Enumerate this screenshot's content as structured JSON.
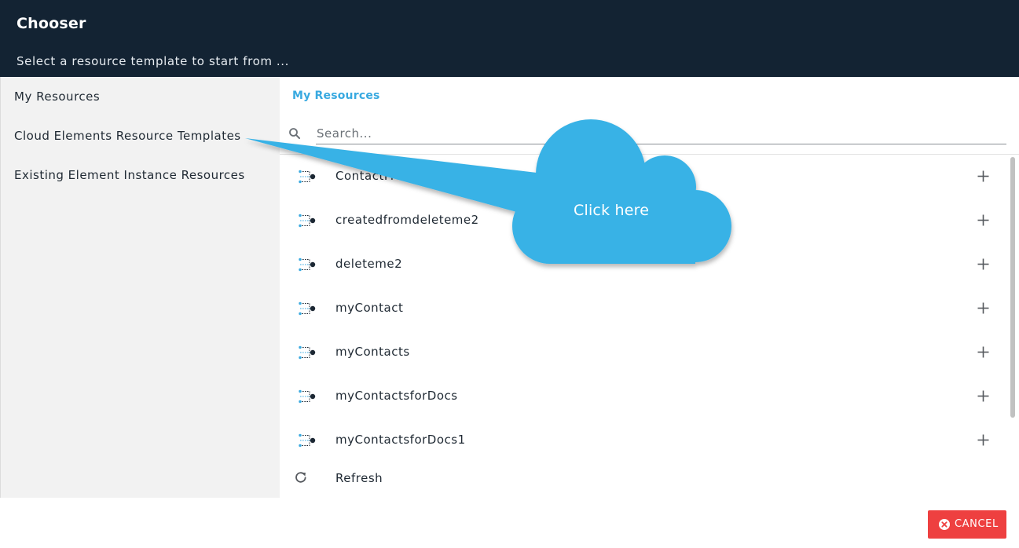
{
  "header": {
    "title": "Chooser",
    "subtitle": "Select a resource template to start from ..."
  },
  "sidebar": {
    "items": [
      {
        "label": "My Resources"
      },
      {
        "label": "Cloud Elements Resource Templates"
      },
      {
        "label": "Existing Element Instance Resources"
      }
    ]
  },
  "main": {
    "section_title": "My Resources",
    "search": {
      "placeholder": "Search..."
    },
    "resources": [
      {
        "name": "ContactFrom"
      },
      {
        "name": "createdfromdeleteme2"
      },
      {
        "name": "deleteme2"
      },
      {
        "name": "myContact"
      },
      {
        "name": "myContacts"
      },
      {
        "name": "myContactsforDocs"
      },
      {
        "name": "myContactsforDocs1"
      }
    ],
    "refresh_label": "Refresh"
  },
  "footer": {
    "cancel_label": "CANCEL"
  },
  "callout": {
    "text": "Click here",
    "color": "#38b2e6"
  },
  "colors": {
    "header_bg": "#132333",
    "accent": "#38a9e0",
    "cancel": "#ee4040",
    "sidebar_bg": "#f2f2f2"
  },
  "icons": {
    "search": "search-icon",
    "resource": "resource-template-icon",
    "add": "plus-icon",
    "refresh": "refresh-icon",
    "cancel": "close-circle-icon"
  }
}
